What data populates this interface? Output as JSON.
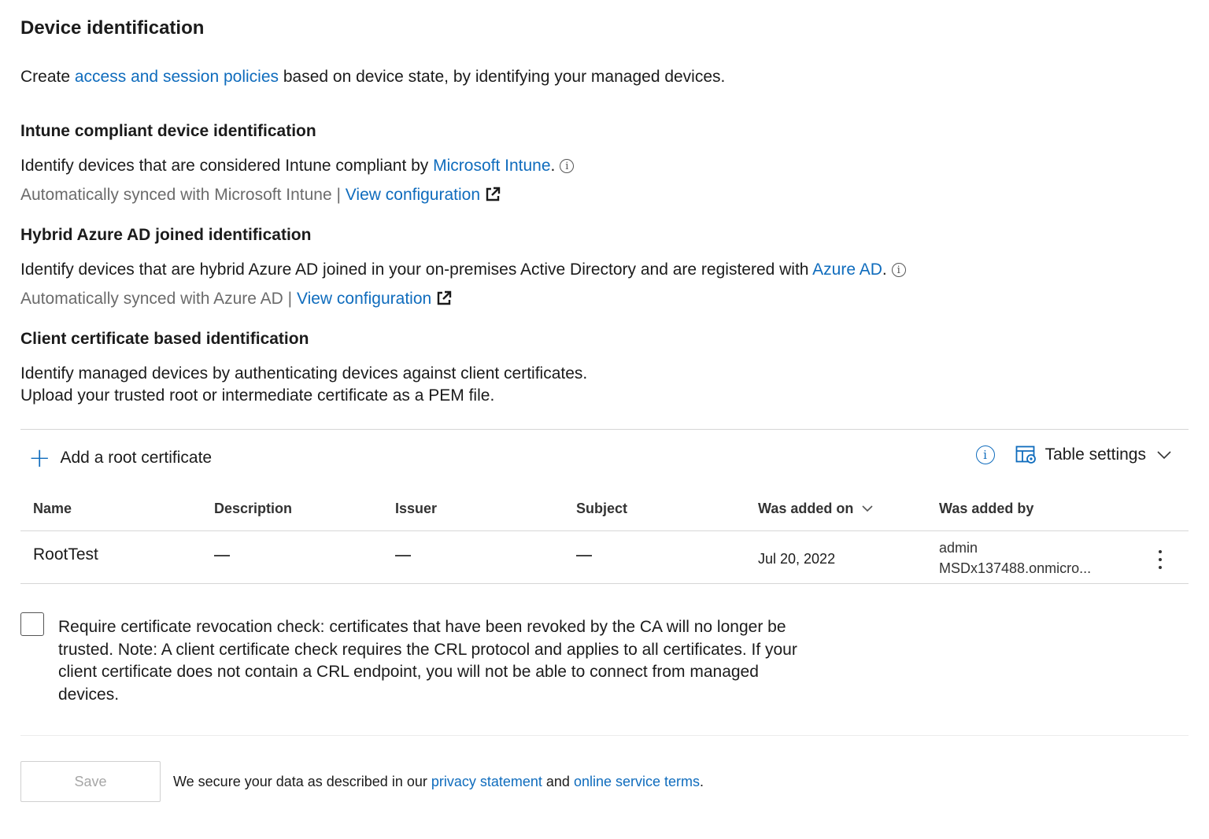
{
  "page": {
    "title": "Device identification",
    "intro": {
      "prefix": "Create ",
      "link": "access and session policies",
      "suffix": " based on device state, by identifying your managed devices."
    }
  },
  "intune": {
    "heading": "Intune compliant device identification",
    "desc_prefix": "Identify devices that are considered Intune compliant by ",
    "desc_link": "Microsoft Intune",
    "desc_suffix": ".",
    "sync_text": "Automatically synced with Microsoft Intune | ",
    "config_link": "View configuration"
  },
  "hybrid": {
    "heading": "Hybrid Azure AD joined identification",
    "desc_prefix": "Identify devices that are hybrid Azure AD joined in your on-premises Active Directory and are registered with ",
    "desc_link": "Azure AD",
    "desc_suffix": ".",
    "sync_text": "Automatically synced with Azure AD | ",
    "config_link": "View configuration"
  },
  "client_cert": {
    "heading": "Client certificate based identification",
    "line1": "Identify managed devices by authenticating devices against client certificates.",
    "line2": "Upload your trusted root or intermediate certificate as a PEM file."
  },
  "toolbar": {
    "add_label": "Add a root certificate",
    "info_glyph": "i",
    "table_settings_label": "Table settings"
  },
  "table": {
    "columns": [
      "Name",
      "Description",
      "Issuer",
      "Subject",
      "Was added on",
      "Was added by"
    ],
    "rows": [
      {
        "name": "RootTest",
        "description": "—",
        "issuer": "—",
        "subject": "—",
        "added_on": "Jul 20, 2022",
        "added_by_line1": "admin",
        "added_by_line2": "MSDx137488.onmicro..."
      }
    ]
  },
  "revocation": {
    "checked": false,
    "label": "Require certificate revocation check: certificates that have been revoked by the CA will no longer be trusted. Note: A client certificate check requires the CRL protocol and applies to all certificates. If your client certificate does not contain a CRL endpoint, you will not be able to connect from managed devices."
  },
  "footer": {
    "save_label": "Save",
    "text_prefix": "We secure your data as described in our ",
    "privacy_link": "privacy statement",
    "text_middle": " and ",
    "terms_link": "online service terms",
    "text_suffix": "."
  },
  "colors": {
    "link": "#0f6cbd",
    "muted": "#6b6b6b",
    "divider": "#d6d6d6"
  },
  "icons": {
    "info": "info-icon",
    "external": "external-link-icon",
    "add": "plus-icon",
    "table_settings": "table-settings-icon",
    "more": "more-vertical-icon",
    "sort": "chevron-down-icon"
  }
}
